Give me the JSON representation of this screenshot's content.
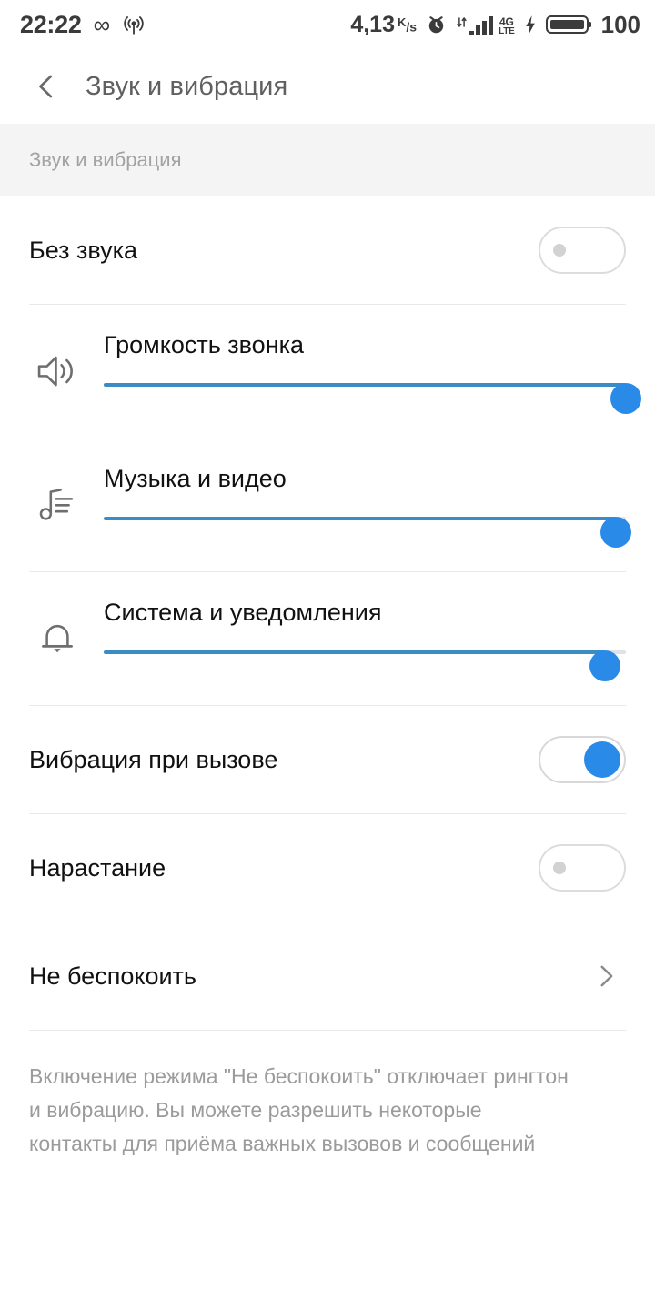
{
  "statusbar": {
    "clock": "22:22",
    "infinity_glyph": "∞",
    "icons_left": [
      "infinity-icon",
      "hotspot-icon"
    ],
    "data_rate": "4,13",
    "data_rate_unit_top": "K",
    "data_rate_unit_bottom": "s",
    "icons_right": [
      "alarm-clock-icon",
      "data-transfer-icon",
      "signal-bars-icon",
      "4g-lte-icon",
      "charging-bolt-icon",
      "battery-icon"
    ],
    "network_line1": "4G",
    "network_line2": "LTE",
    "battery_percent": "100"
  },
  "appbar": {
    "back_icon": "chevron-left-icon",
    "title": "Звук и вибрация"
  },
  "section": {
    "header": "Звук и вибрация"
  },
  "colors": {
    "accent_thumb": "#2a8ae8",
    "accent_track": "#3b8cc4",
    "track_inactive": "#dfe3e6",
    "divider": "#e9e9e9",
    "band_bg": "#f4f4f4",
    "label": "#111111",
    "muted_text": "#9b9b9b",
    "title_text": "#606060"
  },
  "rows": {
    "silent": {
      "label": "Без звука",
      "toggle_state": "off"
    },
    "ring_volume": {
      "label": "Громкость звонка",
      "icon": "speaker-volume-icon",
      "value": 100,
      "min": 0,
      "max": 100
    },
    "music_volume": {
      "label": "Музыка и видео",
      "icon": "music-note-list-icon",
      "value": 98,
      "min": 0,
      "max": 100
    },
    "system_volume": {
      "label": "Система и уведомления",
      "icon": "bell-icon",
      "value": 96,
      "min": 0,
      "max": 100
    },
    "vibrate_on_call": {
      "label": "Вибрация при вызове",
      "toggle_state": "on"
    },
    "increasing_ring": {
      "label": "Нарастание",
      "toggle_state": "off"
    },
    "do_not_disturb": {
      "label": "Не беспокоить",
      "chevron": "chevron-right-icon"
    }
  },
  "footer": {
    "note": "Включение режима \"Не беспокоить\" отключает рингтон и вибрацию. Вы можете разрешить некоторые контакты для приёма важных вызовов и сообщений"
  }
}
